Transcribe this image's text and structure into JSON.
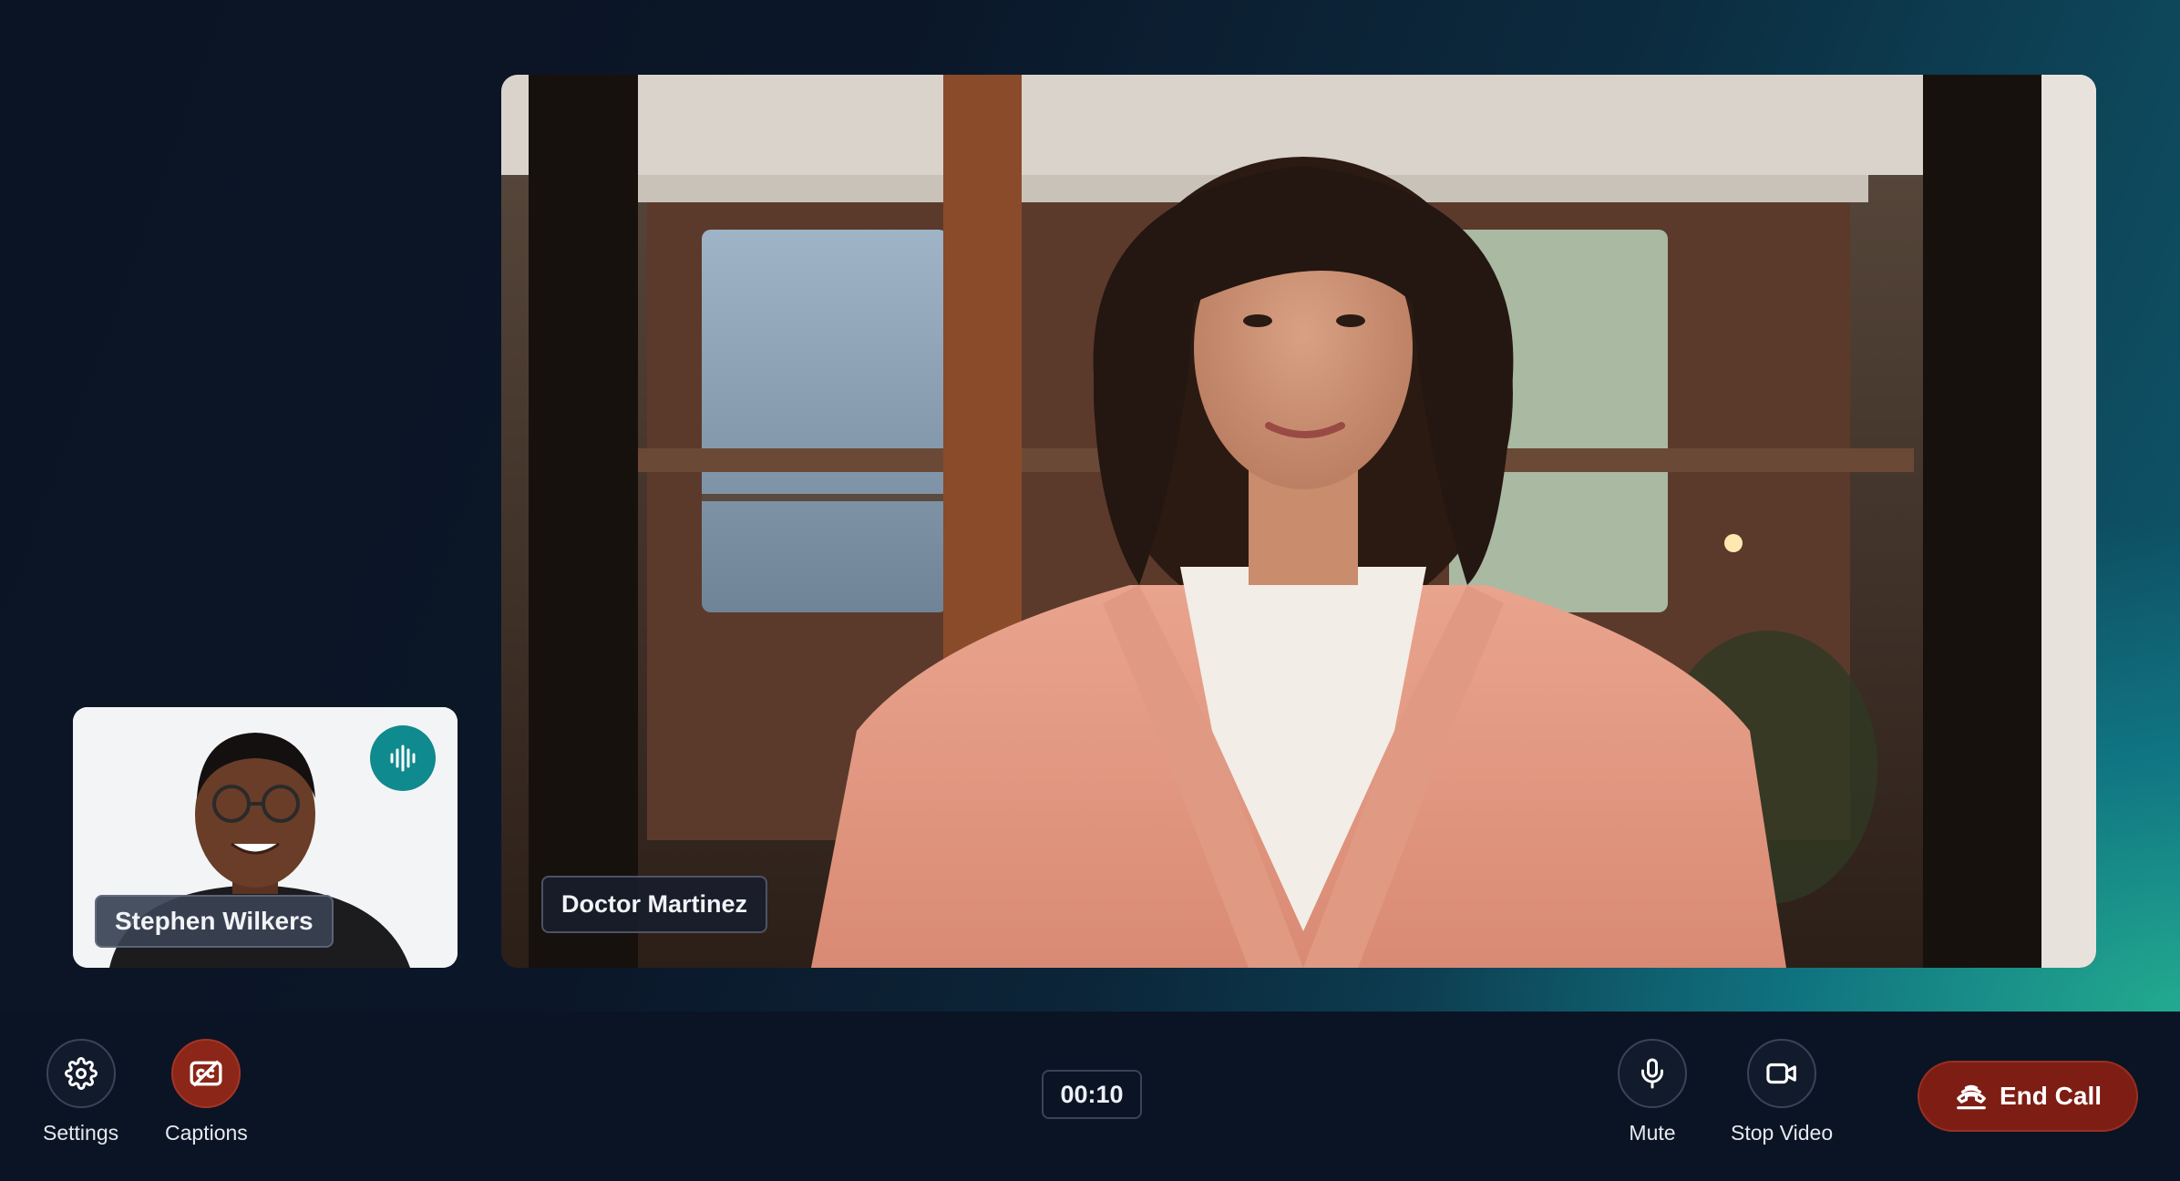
{
  "participants": {
    "main": {
      "name": "Doctor Martinez"
    },
    "self": {
      "name": "Stephen Wilkers",
      "speaking": true
    }
  },
  "toolbar": {
    "settings_label": "Settings",
    "captions_label": "Captions",
    "timer": "00:10",
    "mute_label": "Mute",
    "stop_video_label": "Stop Video",
    "end_call_label": "End Call"
  },
  "colors": {
    "accent_teal": "#0f8a8e",
    "end_call_red": "#7e1d14",
    "captions_active": "#8b2619",
    "toolbar_bg": "#0b1424"
  },
  "icons": {
    "settings": "gear-icon",
    "captions": "closed-captions-icon",
    "mute": "microphone-icon",
    "stop_video": "video-camera-icon",
    "end_call": "phone-hangup-icon",
    "speaking": "audio-waveform-icon"
  }
}
